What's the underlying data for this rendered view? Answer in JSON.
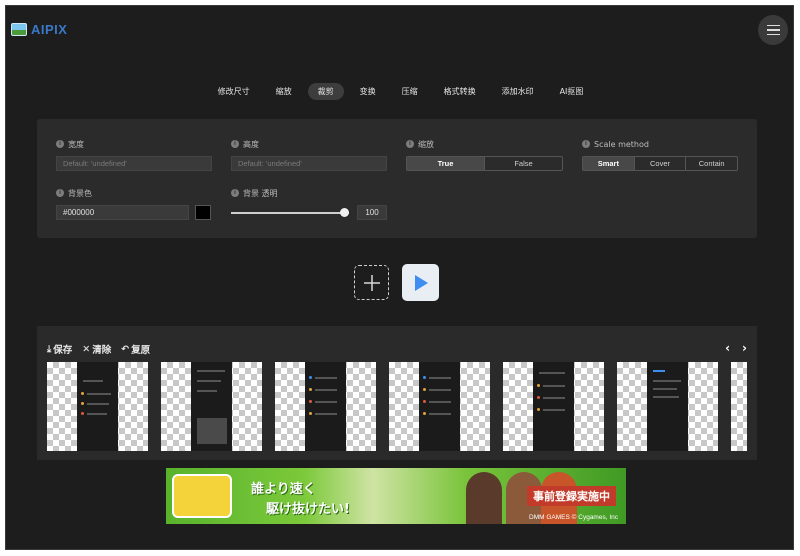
{
  "app": {
    "title": "AIPIX"
  },
  "tabs": [
    {
      "label": "修改尺寸",
      "active": false
    },
    {
      "label": "縮放",
      "active": false
    },
    {
      "label": "裁剪",
      "active": true
    },
    {
      "label": "变换",
      "active": false
    },
    {
      "label": "压缩",
      "active": false
    },
    {
      "label": "格式转换",
      "active": false
    },
    {
      "label": "添加水印",
      "active": false
    },
    {
      "label": "AI抠图",
      "active": false
    }
  ],
  "settings": {
    "width": {
      "label": "宽度",
      "placeholder": "Default: 'undefined'"
    },
    "height": {
      "label": "高度",
      "placeholder": "Default: 'undefined'"
    },
    "scale": {
      "label": "缩放",
      "options": [
        "True",
        "False"
      ],
      "selected": "True"
    },
    "scale_method": {
      "label": "Scale method",
      "options": [
        "Smart",
        "Cover",
        "Contain"
      ],
      "selected": "Smart"
    },
    "bg_color": {
      "label": "背景色",
      "value": "#000000",
      "swatch": "#000000"
    },
    "bg_opacity": {
      "label": "背景 透明",
      "value": "100",
      "level_percent": 100
    }
  },
  "gallery": {
    "save_label": "保存",
    "clear_label": "清除",
    "restore_label": "复原",
    "prev_icon": "chevron-left-icon",
    "next_icon": "chevron-right-icon"
  },
  "banner": {
    "line1": "誰より速く",
    "line2": "駆け抜けたい!",
    "cta": "事前登録実施中",
    "footer": "DMM GAMES © Cygames, Inc"
  },
  "colors": {
    "accent": "#3a78c8",
    "background": "#1d1d1d",
    "panel": "#2b2b2b",
    "play": "#3d8ef0"
  }
}
